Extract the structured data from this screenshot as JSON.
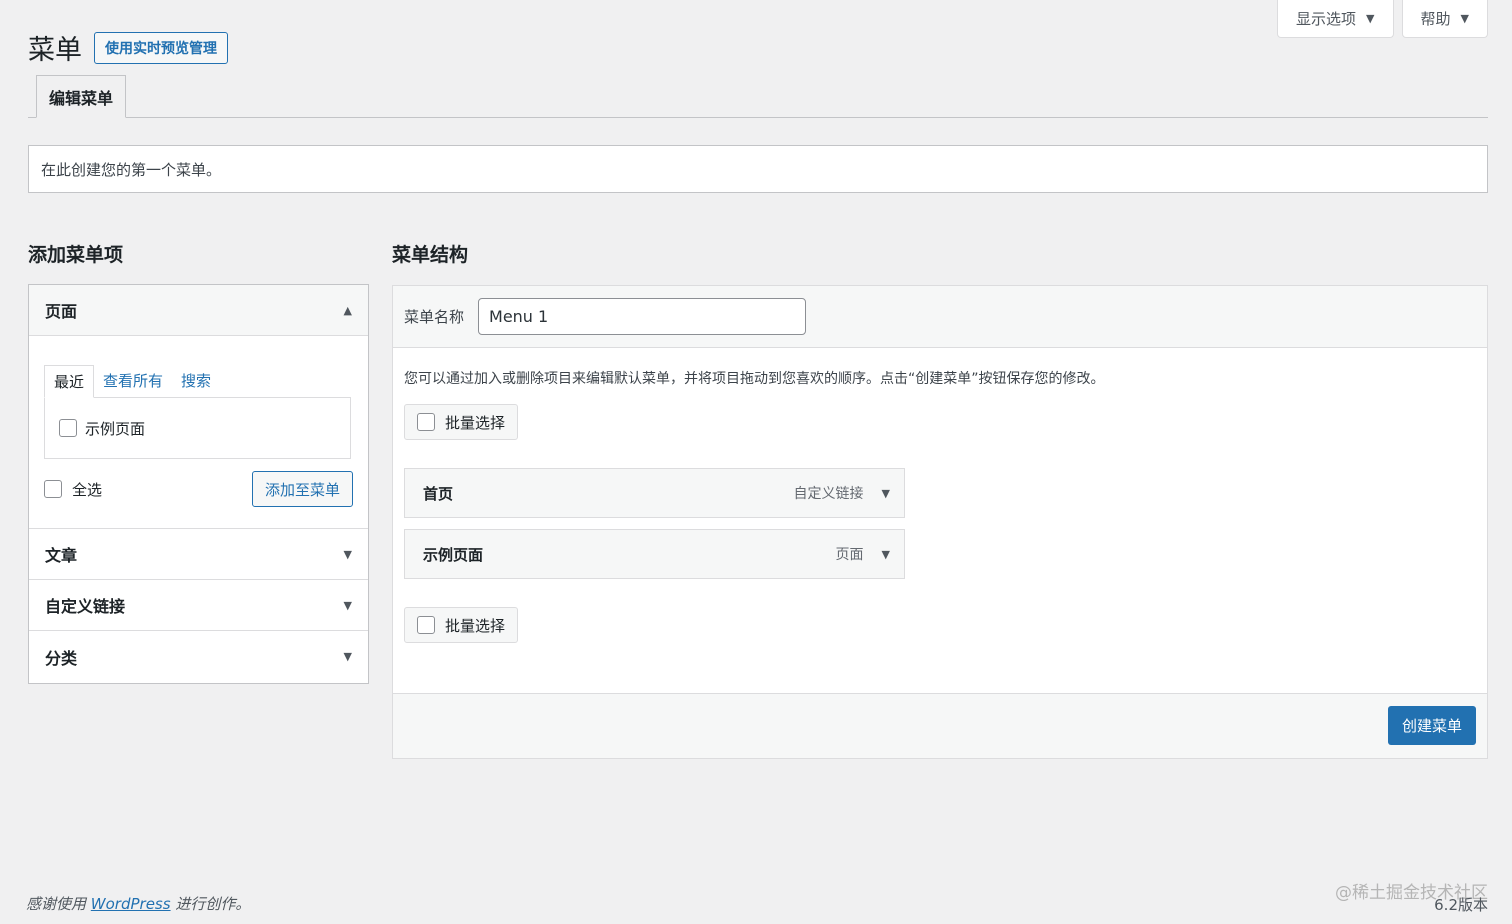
{
  "screen_meta": {
    "screen_options": "显示选项",
    "help": "帮助"
  },
  "header": {
    "title": "菜单",
    "live_preview_button": "使用实时预览管理"
  },
  "tabs": {
    "edit_menus": "编辑菜单"
  },
  "notice": "在此创建您的第一个菜单。",
  "add_items": {
    "heading": "添加菜单项",
    "pages": {
      "title": "页面",
      "tabs": [
        "最近",
        "查看所有",
        "搜索"
      ],
      "items": [
        "示例页面"
      ],
      "select_all": "全选",
      "add_button": "添加至菜单"
    },
    "other_sections": [
      "文章",
      "自定义链接",
      "分类"
    ]
  },
  "structure": {
    "heading": "菜单结构",
    "name_label": "菜单名称",
    "name_value": "Menu 1",
    "description": "您可以通过加入或删除项目来编辑默认菜单，并将项目拖动到您喜欢的顺序。点击“创建菜单”按钮保存您的修改。",
    "bulk_select": "批量选择",
    "items": [
      {
        "title": "首页",
        "type": "自定义链接"
      },
      {
        "title": "示例页面",
        "type": "页面"
      }
    ],
    "create_button": "创建菜单"
  },
  "footer": {
    "thanks_prefix": "感谢使用",
    "thanks_link": "WordPress",
    "thanks_suffix": "进行创作。",
    "watermark": "@稀土掘金技术社区",
    "version": "6.2版本"
  },
  "colors": {
    "primary": "#2271b1",
    "background": "#f0f0f1"
  }
}
